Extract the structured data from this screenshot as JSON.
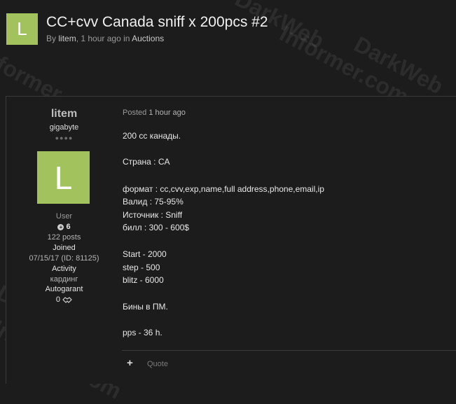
{
  "thread": {
    "avatar_letter": "L",
    "title": "CC+cvv Canada sniff x 200pcs #2",
    "by_prefix": "By",
    "author": "litem",
    "time": ", 1 hour ago in",
    "forum": "Auctions"
  },
  "author": {
    "name": "litem",
    "title": "gigabyte",
    "pips": "●●●●",
    "avatar_letter": "L",
    "group": "User",
    "reputation": "6",
    "posts": "122 posts",
    "joined_label": "Joined",
    "joined_value": "07/15/17 (ID: 81125)",
    "activity_label": "Activity",
    "activity_value": "кардинг",
    "autogarant_label": "Autogarant",
    "autogarant_value": "0"
  },
  "post": {
    "posted_label": "Posted",
    "posted_time": "1 hour ago",
    "lines": [
      "200 cc канады.",
      "Страна : CA",
      "формат : cc,cvv,exp,name,full address,phone,email,ip",
      "Валид  : 75-95%",
      "Источник : Sniff",
      "билл : 300 - 600$",
      "Start - 2000",
      "step - 500",
      "blitz - 6000",
      "Бины в ПМ.",
      "pps - 36 h."
    ]
  },
  "actions": {
    "plus": "+",
    "quote_label": "Quote"
  },
  "watermark": [
    "DarkWeb",
    "Informer.com"
  ],
  "colors": {
    "background": "#1c1c1c",
    "avatar": "#a2c25e",
    "border": "#3a3a3a"
  }
}
